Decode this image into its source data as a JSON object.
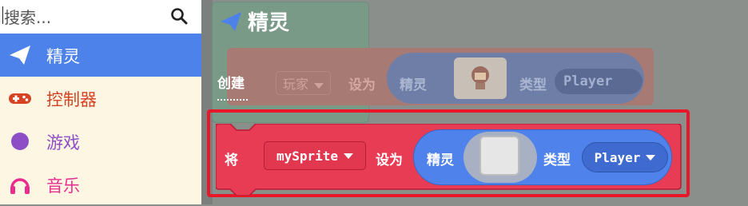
{
  "search": {
    "placeholder": "搜索..."
  },
  "toolbox": {
    "categories": [
      {
        "label": "精灵",
        "icon": "paper-plane-icon",
        "color": "#4c82e9"
      },
      {
        "label": "控制器",
        "icon": "gamepad-icon",
        "color": "#d54322"
      },
      {
        "label": "游戏",
        "icon": "circle-icon",
        "color": "#8e4ec6"
      },
      {
        "label": "音乐",
        "icon": "headphones-icon",
        "color": "#e63022"
      }
    ]
  },
  "flyout": {
    "title": "精灵",
    "section_label": "创建",
    "ghost_block": {
      "set_label": "设为",
      "variable": "玩家",
      "sprite_label": "精灵",
      "kind_label": "类型",
      "kind_value": "Player"
    }
  },
  "block": {
    "set_label": "将",
    "variable": "mySprite",
    "to_label": "设为",
    "sprite_label": "精灵",
    "kind_label": "类型",
    "kind_value": "Player",
    "color": "#e83c55"
  }
}
